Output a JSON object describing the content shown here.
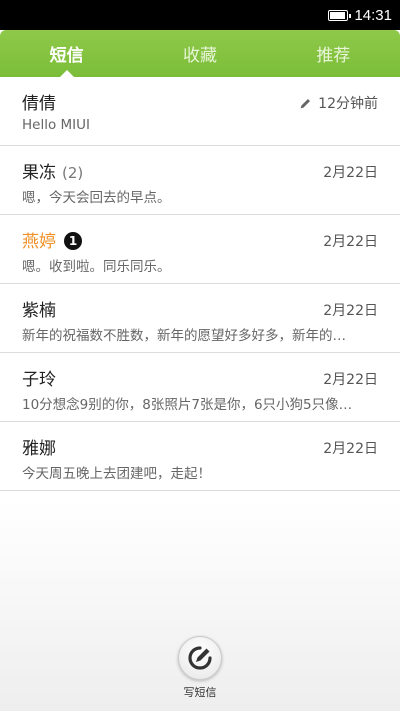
{
  "status_bar": {
    "time": "14:31",
    "battery_level": 0.9
  },
  "tabs": [
    {
      "label": "短信",
      "active": true
    },
    {
      "label": "收藏",
      "active": false
    },
    {
      "label": "推荐",
      "active": false
    }
  ],
  "messages": [
    {
      "name": "倩倩",
      "preview": "Hello MIUI",
      "time": "12分钟前",
      "draft_icon": "pencil-icon"
    },
    {
      "name": "果冻",
      "count": "(2)",
      "preview": "嗯，今天会回去的早点。",
      "time": "2月22日"
    },
    {
      "name": "燕婷",
      "unread": "1",
      "preview": "嗯。收到啦。同乐同乐。",
      "time": "2月22日",
      "highlight_color": "#f19026"
    },
    {
      "name": "紫楠",
      "preview": "新年的祝福数不胜数，新年的愿望好多好多，新年的…",
      "time": "2月22日"
    },
    {
      "name": "子玲",
      "preview": "10分想念9别的你，8张照片7张是你，6只小狗5只像…",
      "time": "2月22日"
    },
    {
      "name": "雅娜",
      "preview": "今天周五晚上去团建吧，走起！",
      "time": "2月22日"
    }
  ],
  "compose": {
    "label": "写短信",
    "icon": "compose-icon"
  },
  "colors": {
    "accent": "#7bbd38",
    "highlight": "#f19026"
  }
}
